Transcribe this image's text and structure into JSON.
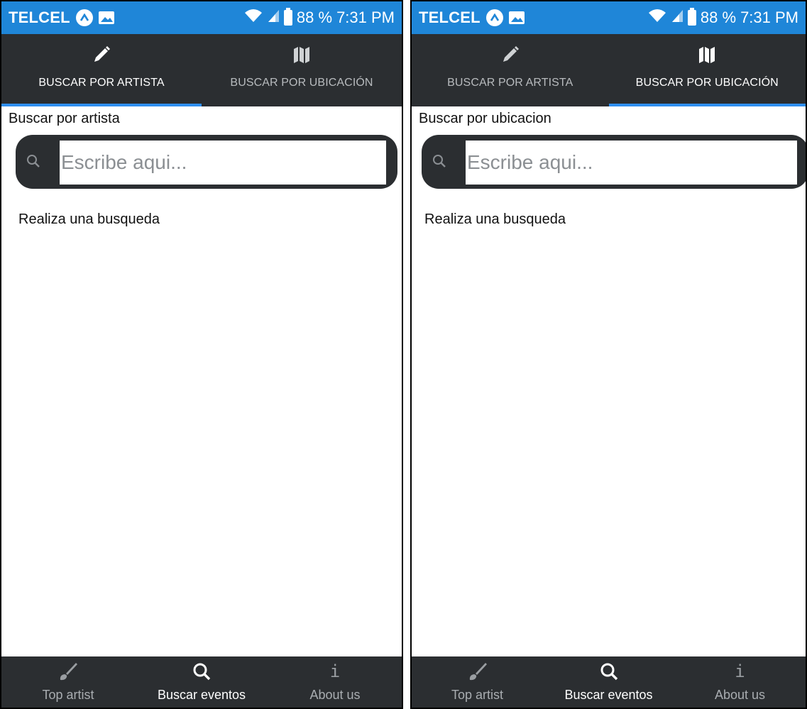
{
  "colors": {
    "statusbar": "#1f86d8",
    "dark": "#2b2e31",
    "accent": "#2f8ff0",
    "inactive_text": "#b8bbbe"
  },
  "status": {
    "carrier": "TELCEL",
    "battery": "88 %",
    "time": "7:31 PM",
    "icons": [
      "app-badge-icon",
      "image-icon",
      "wifi-icon",
      "signal-icon",
      "battery-icon"
    ]
  },
  "tabs": [
    {
      "label": "BUSCAR POR ARTISTA",
      "icon": "pencil-icon"
    },
    {
      "label": "BUSCAR POR UBICACIÓN",
      "icon": "map-icon"
    }
  ],
  "screens": [
    {
      "active_tab": 0,
      "section_title": "Buscar por artista",
      "search": {
        "placeholder": "Escribe aqui...",
        "value": ""
      },
      "empty_message": "Realiza una busqueda"
    },
    {
      "active_tab": 1,
      "section_title": "Buscar por ubicacion",
      "search": {
        "placeholder": "Escribe aqui...",
        "value": ""
      },
      "empty_message": "Realiza una busqueda"
    }
  ],
  "bottom_nav": {
    "active": 1,
    "items": [
      {
        "label": "Top artist",
        "icon": "brush-icon"
      },
      {
        "label": "Buscar eventos",
        "icon": "search-icon"
      },
      {
        "label": "About us",
        "icon": "info-icon"
      }
    ]
  }
}
